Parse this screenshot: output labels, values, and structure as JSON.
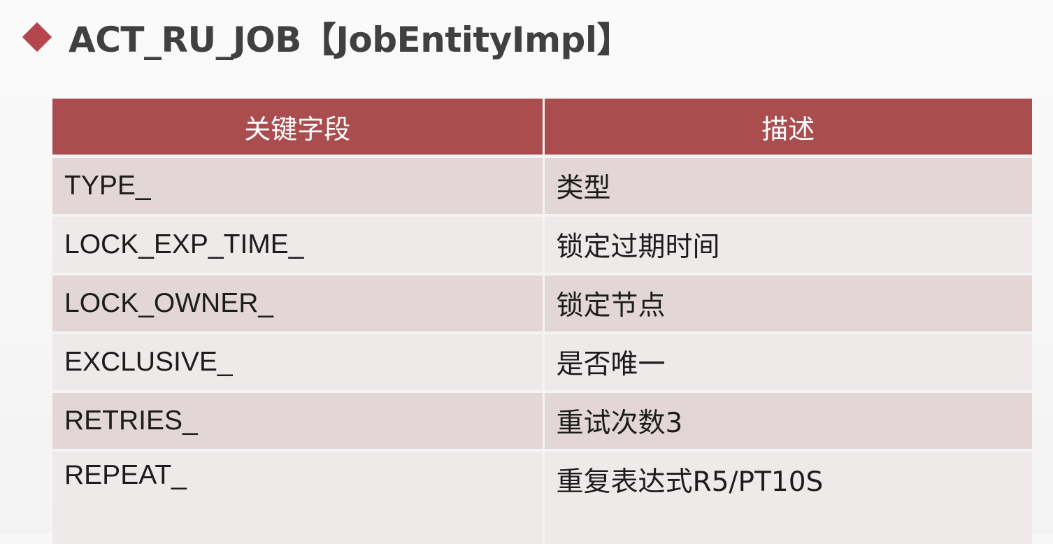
{
  "slide": {
    "title": "ACT_RU_JOB【JobEntityImpl】",
    "colors": {
      "accent": "#b5474c",
      "header_bg": "#aa4d4f",
      "row_dark": "#e3d6d6",
      "row_light": "#efeaea"
    },
    "bullet_icon": "diamond-bullet-icon"
  },
  "table": {
    "headers": [
      "关键字段",
      "描述"
    ],
    "rows": [
      {
        "field": "TYPE_",
        "desc": "类型"
      },
      {
        "field": "LOCK_EXP_TIME_",
        "desc": "锁定过期时间"
      },
      {
        "field": "LOCK_OWNER_",
        "desc": "锁定节点"
      },
      {
        "field": "EXCLUSIVE_",
        "desc": "是否唯一"
      },
      {
        "field": "RETRIES_",
        "desc": "重试次数3"
      },
      {
        "field": "REPEAT_",
        "desc": "重复表达式R5/PT10S"
      }
    ]
  }
}
